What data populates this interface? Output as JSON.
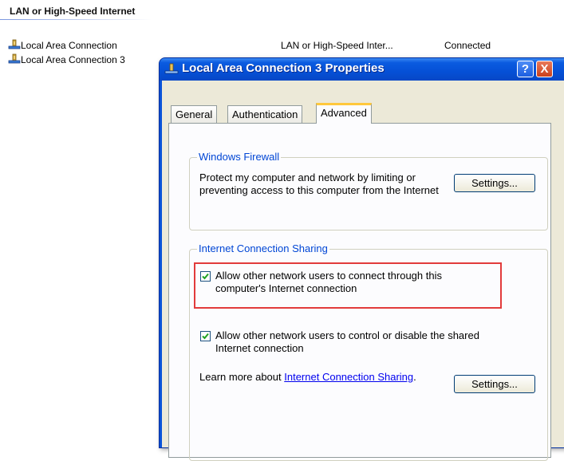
{
  "background": {
    "group_header": "LAN or High-Speed Internet",
    "connections": [
      {
        "name": "Local Area Connection",
        "type": "LAN or High-Speed Inter...",
        "status": "Connected",
        "icon": "network-connection-icon"
      },
      {
        "name": "Local Area Connection 3",
        "type": "",
        "status": "",
        "icon": "network-connection-icon"
      }
    ]
  },
  "dialog": {
    "title": "Local Area Connection 3 Properties",
    "help_label": "?",
    "close_label": "X",
    "tabs": [
      {
        "label": "General",
        "active": false
      },
      {
        "label": "Authentication",
        "active": false
      },
      {
        "label": "Advanced",
        "active": true
      }
    ],
    "firewall": {
      "legend": "Windows Firewall",
      "description": "Protect my computer and network by limiting or preventing access to this computer from the Internet",
      "settings_label": "Settings..."
    },
    "ics": {
      "legend": "Internet Connection Sharing",
      "allow_connect": {
        "label": "Allow other network users to connect through this computer's Internet connection",
        "checked": true
      },
      "allow_control": {
        "label": "Allow other network users to control or disable the shared Internet connection",
        "checked": true
      },
      "learn_more_prefix": "Learn more about",
      "learn_more_link": "Internet Connection Sharing",
      "learn_more_suffix": ".",
      "settings_label": "Settings..."
    }
  },
  "colors": {
    "title_bar": "#0a53d8",
    "group_legend": "#0046d5",
    "active_tab_accent": "#ffc83c",
    "highlight": "#e23b3b",
    "link": "#0000ee",
    "checkmark": "#21a121"
  }
}
